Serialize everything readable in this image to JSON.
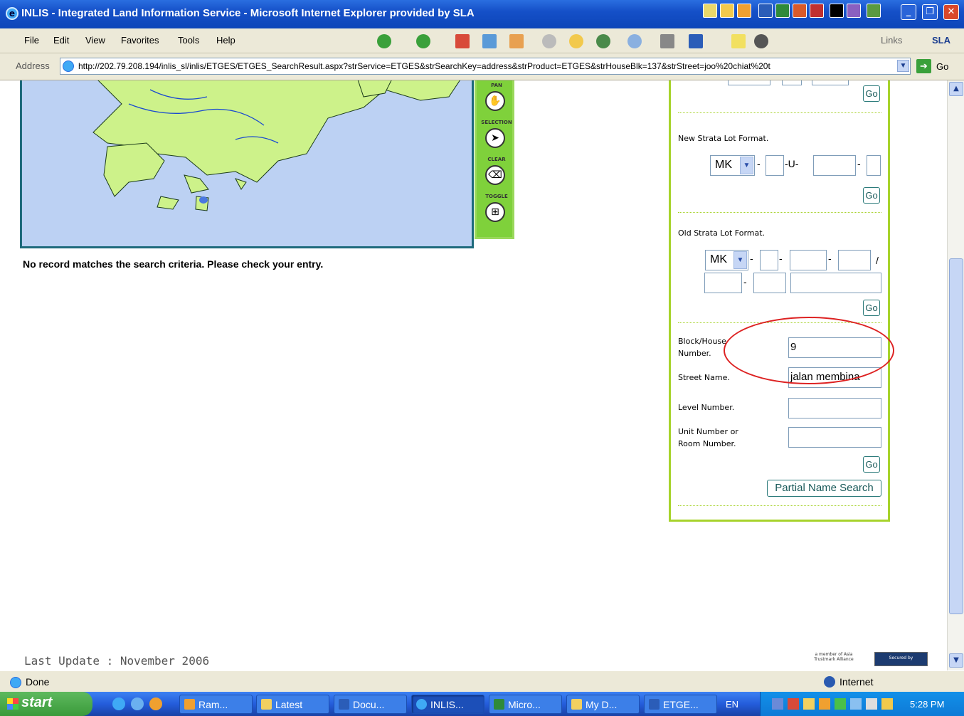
{
  "window": {
    "title": "INLIS - Integrated Land Information Service - Microsoft Internet Explorer provided by SLA"
  },
  "menu": [
    "File",
    "Edit",
    "View",
    "Favorites",
    "Tools",
    "Help"
  ],
  "toolbar": {
    "links": "Links",
    "brand": "SLA"
  },
  "address": {
    "label": "Address",
    "url": "http://202.79.208.194/inlis_sl/inlis/ETGES/ETGES_SearchResult.aspx?strService=ETGES&strSearchKey=address&strProduct=ETGES&strHouseBlk=137&strStreet=joo%20chiat%20t",
    "go": "Go"
  },
  "map": {
    "tools": [
      "PAN",
      "SELECTION",
      "CLEAR",
      "TOGGLE"
    ]
  },
  "message": "No record matches the search criteria. Please check your entry.",
  "panel": {
    "new_strata_title": "New Strata Lot Format.",
    "new_strata_select": "MK",
    "new_strata_u": "-U-",
    "old_strata_title": "Old Strata Lot Format.",
    "old_strata_select": "MK",
    "block_label": "Block/House Number.",
    "block_value": "9",
    "street_label": "Street Name.",
    "street_value": "jalan membina",
    "level_label": "Level Number.",
    "unit_label": "Unit Number or Room Number.",
    "go": "Go",
    "partial": "Partial Name Search"
  },
  "footer": {
    "last_update": "Last Update : November 2006",
    "badge1": "a member of Asia Trustmark Alliance",
    "badge2": "Secured by"
  },
  "status": {
    "text": "Done",
    "zone": "Internet"
  },
  "taskbar": {
    "start": "start",
    "tasks": [
      "Ram...",
      "Latest",
      "Docu...",
      "INLIS...",
      "Micro...",
      "My D...",
      "ETGE..."
    ],
    "lang": "EN",
    "clock": "5:28 PM"
  }
}
